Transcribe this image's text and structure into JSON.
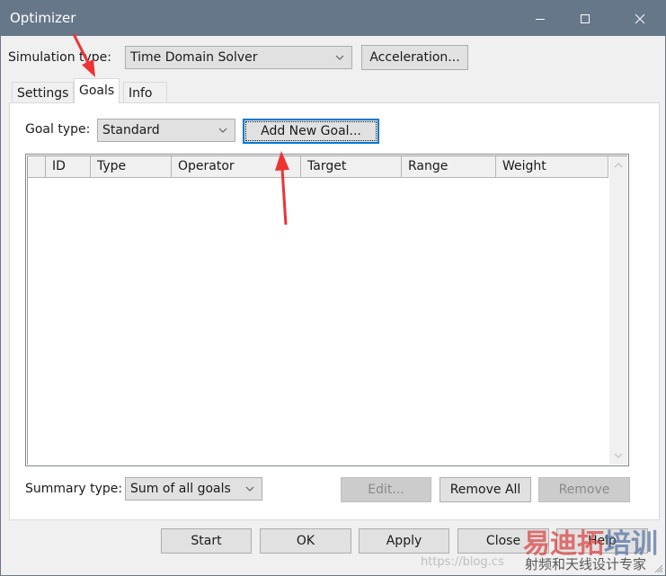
{
  "window": {
    "title": "Optimizer",
    "controls": {
      "minimize": "minimize-icon",
      "maximize": "maximize-icon",
      "close": "close-icon"
    }
  },
  "top": {
    "simulation_type_label": "Simulation type:",
    "simulation_type_value": "Time Domain Solver",
    "acceleration_button": "Acceleration..."
  },
  "tabs": [
    {
      "label": "Settings",
      "active": false
    },
    {
      "label": "Goals",
      "active": true
    },
    {
      "label": "Info",
      "active": false
    }
  ],
  "goals": {
    "goal_type_label": "Goal type:",
    "goal_type_value": "Standard",
    "add_goal_button": "Add New Goal...",
    "table": {
      "columns": [
        "",
        "ID",
        "Type",
        "Operator",
        "Target",
        "Range",
        "Weight"
      ],
      "rows": []
    },
    "summary_type_label": "Summary type:",
    "summary_type_value": "Sum of all goals",
    "edit_button": "Edit...",
    "remove_all_button": "Remove All",
    "remove_button": "Remove"
  },
  "footer": {
    "start_button": "Start",
    "ok_button": "OK",
    "apply_button": "Apply",
    "close_button": "Close",
    "help_button": "Help"
  },
  "watermark": {
    "brand_red": "易迪拓",
    "brand_blue": "培训",
    "url": "https://blog.cs",
    "subtitle": "射频和天线设计专家"
  },
  "annotations": {
    "arrow_color": "#ee3333"
  },
  "colors": {
    "titlebar": "#67778a",
    "focus": "#0078d7"
  }
}
